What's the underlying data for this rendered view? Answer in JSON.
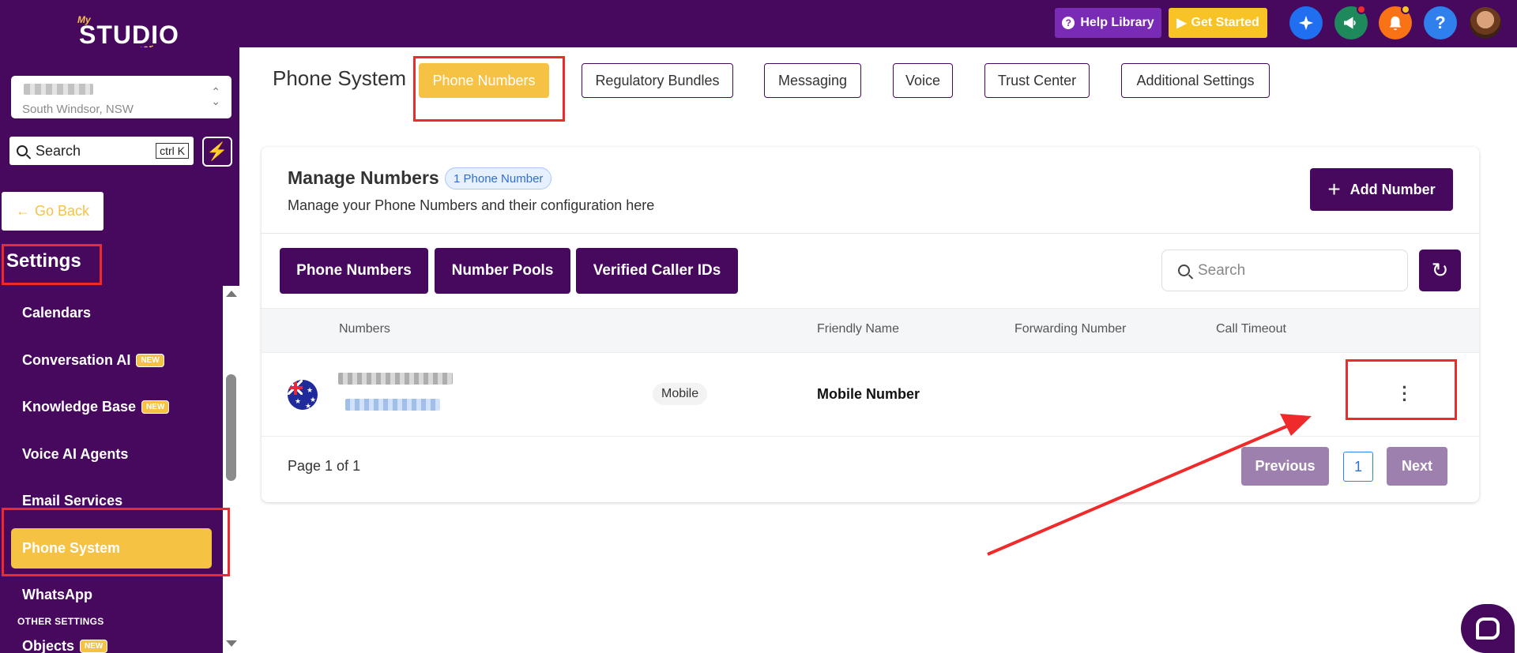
{
  "app": {
    "logo_my": "My",
    "logo_studio": "STUDIO",
    "logo_manager": "Manager"
  },
  "topbar": {
    "help_library": "Help Library",
    "get_started": "Get Started",
    "icons": [
      "ai-sparkle-icon",
      "megaphone-icon",
      "bell-icon",
      "help-icon",
      "user-avatar"
    ],
    "help_glyph": "?",
    "colors": {
      "bar": "#46095e",
      "help": "#7a2bb5",
      "start": "#f7c325"
    }
  },
  "sidebar": {
    "location_city": "South Windsor, NSW",
    "search_label": "Search",
    "search_shortcut": "ctrl K",
    "go_back": "Go Back",
    "section_title": "Settings",
    "items": [
      {
        "label": "Calendars",
        "badge": ""
      },
      {
        "label": "Conversation AI",
        "badge": "NEW"
      },
      {
        "label": "Knowledge Base",
        "badge": "NEW"
      },
      {
        "label": "Voice AI Agents",
        "badge": ""
      },
      {
        "label": "Email Services",
        "badge": ""
      },
      {
        "label": "Phone System",
        "badge": "",
        "active": true
      },
      {
        "label": "WhatsApp",
        "badge": ""
      }
    ],
    "other_settings_label": "OTHER SETTINGS",
    "objects_item": {
      "label": "Objects",
      "badge": "NEW"
    }
  },
  "header": {
    "title": "Phone System",
    "tabs": [
      {
        "label": "Phone Numbers",
        "active": true
      },
      {
        "label": "Regulatory Bundles"
      },
      {
        "label": "Messaging"
      },
      {
        "label": "Voice"
      },
      {
        "label": "Trust Center"
      },
      {
        "label": "Additional Settings"
      }
    ]
  },
  "manage": {
    "title": "Manage Numbers",
    "count_badge": "1 Phone Number",
    "subtitle": "Manage your Phone Numbers and their configuration here",
    "add_button": "Add Number",
    "sub_tabs": [
      "Phone Numbers",
      "Number Pools",
      "Verified Caller IDs"
    ],
    "search_placeholder": "Search",
    "columns": [
      "Numbers",
      "Friendly Name",
      "Forwarding Number",
      "Call Timeout"
    ],
    "rows": [
      {
        "type": "Mobile",
        "friendly_name": "Mobile Number",
        "forwarding": "",
        "timeout": ""
      }
    ],
    "page_info": "Page 1 of 1",
    "prev": "Previous",
    "page": "1",
    "next": "Next"
  }
}
